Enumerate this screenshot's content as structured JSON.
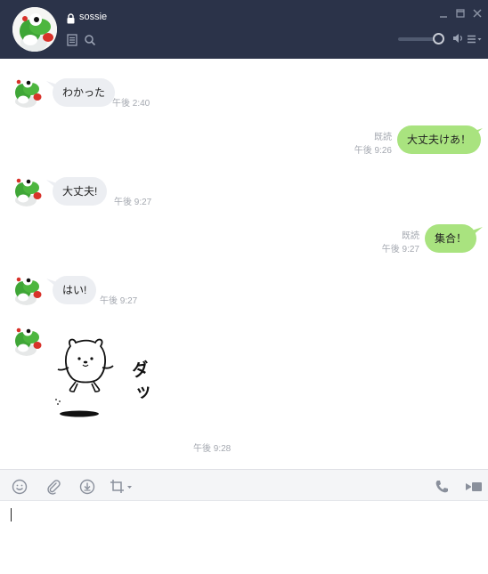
{
  "header": {
    "contact_name": "sossie",
    "colors": {
      "background": "#2b3349",
      "icon": "#9aa2b3"
    },
    "volume_level": 0.9
  },
  "messages": [
    {
      "direction": "incoming",
      "text": "わかった",
      "time": "午後 2:40"
    },
    {
      "direction": "outgoing",
      "text": "大丈夫けあ！",
      "time": "午後 9:26",
      "read_label": "既読"
    },
    {
      "direction": "incoming",
      "text": "大丈夫!",
      "time": "午後 9:27"
    },
    {
      "direction": "outgoing",
      "text": "集合！",
      "time": "午後 9:27",
      "read_label": "既読"
    },
    {
      "direction": "incoming",
      "text": "はい!",
      "time": "午後 9:27"
    },
    {
      "direction": "incoming",
      "type": "sticker",
      "sticker_text": "ダッ",
      "time": "午後 9:28"
    }
  ],
  "icons": {
    "lock": "lock-icon",
    "note": "note-icon",
    "search": "search-icon",
    "minimize": "minimize-icon",
    "maximize": "maximize-icon",
    "close": "close-icon",
    "speaker": "speaker-icon",
    "menu": "menu-icon",
    "emoji": "emoji-icon",
    "attach": "paperclip-icon",
    "download": "download-icon",
    "crop": "crop-icon",
    "phone": "phone-icon",
    "video": "video-icon"
  },
  "colors": {
    "incoming_bubble": "#eceef2",
    "outgoing_bubble": "#a9e37f",
    "timestamp": "#a4a8b0"
  },
  "composer": {
    "value": ""
  }
}
